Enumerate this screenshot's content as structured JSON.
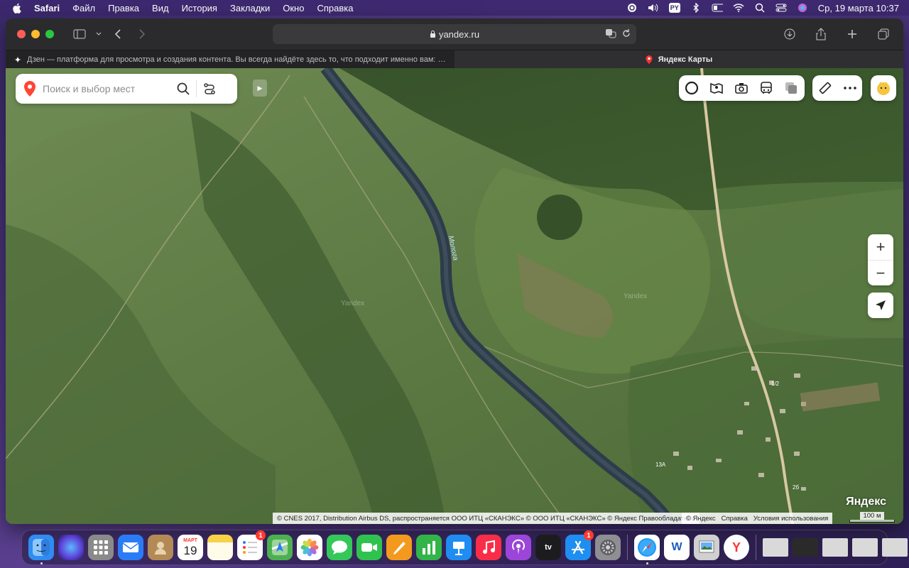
{
  "menubar": {
    "app": "Safari",
    "menus": [
      "Файл",
      "Правка",
      "Вид",
      "История",
      "Закладки",
      "Окно",
      "Справка"
    ],
    "input_badge": "PY",
    "datetime": "Ср, 19 марта  10:37"
  },
  "browser": {
    "url": "yandex.ru",
    "tabs": [
      {
        "label": "Дзен — платформа для просмотра и создания контента. Вы всегда найдёте здесь то, что подходит именно вам: стн...",
        "icon": "sparkle-icon",
        "active": false
      },
      {
        "label": "Яндекс Карты",
        "icon": "map-pin-icon",
        "active": true
      }
    ]
  },
  "map": {
    "search_placeholder": "Поиск и выбор мест",
    "watermarks": [
      "Yandex",
      "Yandex"
    ],
    "river_label": "Молога",
    "house_labels": [
      "13А",
      "2б",
      "1/2"
    ],
    "logo": "Яндекс",
    "copyright": "© CNES 2017, Distribution Airbus DS, распространяется ООО ИТЦ «СКАНЭКС» © ООО ИТЦ «СКАНЭКС» © Яндекс   Правообладатели",
    "footer_links": [
      "© Яндекс",
      "Справка",
      "Условия использования"
    ],
    "scale": "100 м",
    "zoom_in": "+",
    "zoom_out": "−"
  },
  "dock": {
    "apps": [
      {
        "name": "Finder",
        "color": "#2f8cf0"
      },
      {
        "name": "Siri",
        "color": "#5b3fd6"
      },
      {
        "name": "Launchpad",
        "color": "#8a8a8a"
      },
      {
        "name": "Mail",
        "color": "#2a7cf6"
      },
      {
        "name": "Contacts",
        "color": "#b38a55"
      },
      {
        "name": "Calendar",
        "color": "#ffffff",
        "month": "МАРТ",
        "day": "19"
      },
      {
        "name": "Notes",
        "color": "#f7d147"
      },
      {
        "name": "Reminders",
        "color": "#ffffff",
        "badge": "1"
      },
      {
        "name": "Maps",
        "color": "#4cb050"
      },
      {
        "name": "Photos",
        "color": "#ffffff"
      },
      {
        "name": "Messages",
        "color": "#34c759"
      },
      {
        "name": "FaceTime",
        "color": "#30c24f"
      },
      {
        "name": "Pages",
        "color": "#f39a1e"
      },
      {
        "name": "Numbers",
        "color": "#32b548"
      },
      {
        "name": "Keynote",
        "color": "#1f8cf2"
      },
      {
        "name": "Music",
        "color": "#fa2d48"
      },
      {
        "name": "Podcasts",
        "color": "#9b45d9"
      },
      {
        "name": "TV",
        "color": "#1c1c1e",
        "label": "tv"
      },
      {
        "name": "App Store",
        "color": "#1f8ef1",
        "badge": "1"
      },
      {
        "name": "System Settings",
        "color": "#8e8e93"
      },
      {
        "name": "Safari",
        "color": "#1a9af7"
      },
      {
        "name": "Word",
        "color": "#ffffff",
        "label": "W"
      },
      {
        "name": "Preview",
        "color": "#d0d0d0"
      },
      {
        "name": "Yandex Browser",
        "color": "#ffffff",
        "label": "Y"
      }
    ]
  }
}
